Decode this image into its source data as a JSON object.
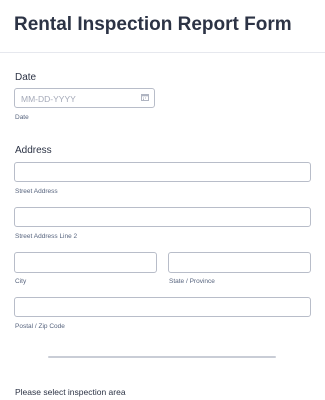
{
  "form": {
    "title": "Rental Inspection Report Form",
    "date": {
      "label": "Date",
      "placeholder": "MM-DD-YYYY",
      "sublabel": "Date",
      "icon": "calendar-icon"
    },
    "address": {
      "label": "Address",
      "street": "Street Address",
      "street2": "Street Address Line 2",
      "city": "City",
      "state": "State / Province",
      "postal": "Postal / Zip Code"
    },
    "inspection_area_label": "Please select inspection area"
  }
}
